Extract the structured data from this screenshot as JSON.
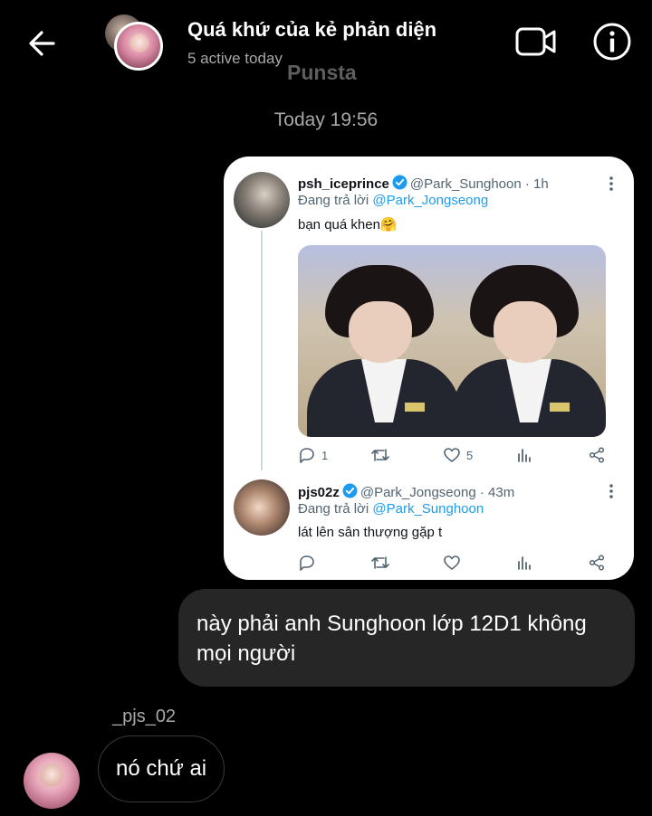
{
  "header": {
    "title": "Quá khứ của kẻ phản diện",
    "status": "5 active today",
    "watermark": "Punsta"
  },
  "conversation": {
    "timestamp": "Today 19:56"
  },
  "shared_thread": {
    "tweets": [
      {
        "name": "psh_iceprince",
        "handle": "@Park_Sunghoon",
        "age": "· 1h",
        "reply_prefix": "Đang trả lời",
        "reply_to": "@Park_Jongseong",
        "text": "bạn quá khen🤗",
        "replies": "1",
        "retweets": "",
        "likes": "5"
      },
      {
        "name": "pjs02z",
        "handle": "@Park_Jongseong",
        "age": "· 43m",
        "reply_prefix": "Đang trả lời",
        "reply_to": "@Park_Sunghoon",
        "text": "lát lên sân thượng gặp t",
        "replies": "",
        "retweets": "",
        "likes": ""
      }
    ],
    "verified_color": "#1d9bf0"
  },
  "messages": {
    "outgoing": "này phải anh Sunghoon lớp 12D1 không mọi người",
    "incoming_sender": "_pjs_02",
    "incoming": "nó chứ ai"
  }
}
